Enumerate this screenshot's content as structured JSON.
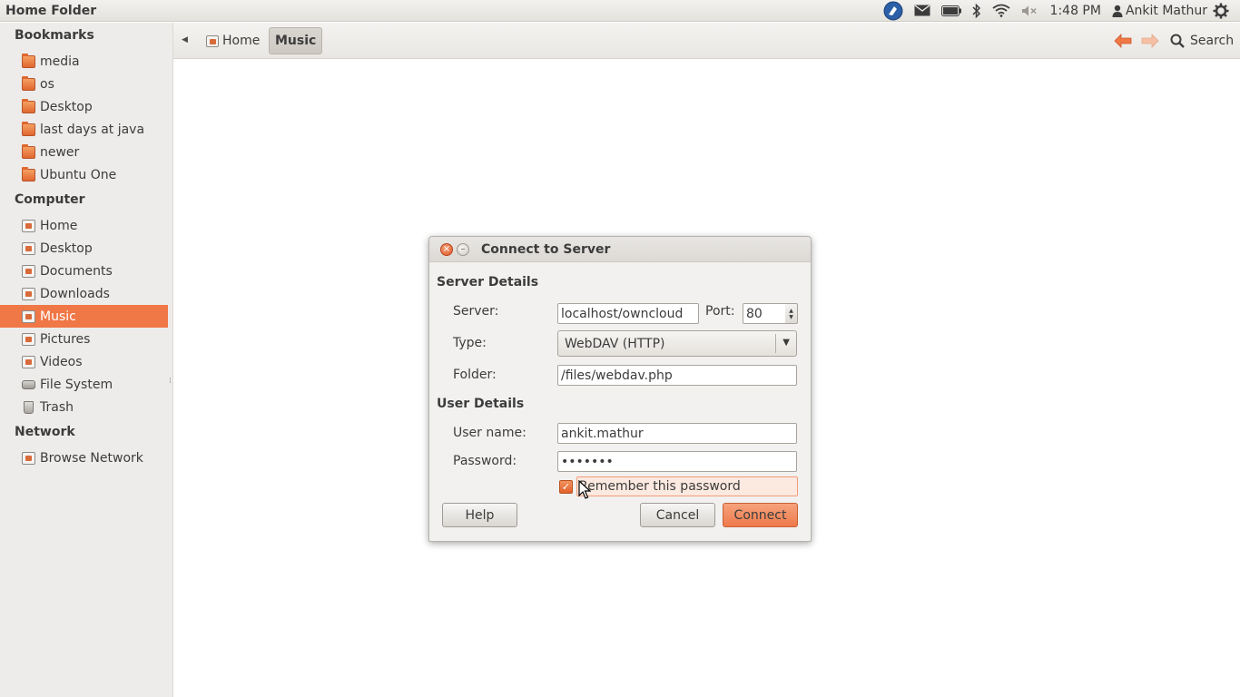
{
  "window_title": "Home Folder",
  "panel": {
    "clock": "1:48 PM",
    "user": "Ankit Mathur",
    "icons": [
      "app-indicator-icon",
      "mail-icon",
      "battery-icon",
      "bluetooth-icon",
      "wifi-icon",
      "volume-muted-icon",
      "user-icon",
      "session-gear-icon"
    ]
  },
  "sidebar": {
    "bookmarks_header": "Bookmarks",
    "bookmarks": [
      {
        "label": "media"
      },
      {
        "label": "os"
      },
      {
        "label": "Desktop"
      },
      {
        "label": "last days at java"
      },
      {
        "label": "newer"
      },
      {
        "label": "Ubuntu One"
      }
    ],
    "computer_header": "Computer",
    "computer": [
      {
        "label": "Home"
      },
      {
        "label": "Desktop"
      },
      {
        "label": "Documents"
      },
      {
        "label": "Downloads"
      },
      {
        "label": "Music",
        "selected": true
      },
      {
        "label": "Pictures"
      },
      {
        "label": "Videos"
      },
      {
        "label": "File System"
      },
      {
        "label": "Trash"
      }
    ],
    "network_header": "Network",
    "network": [
      {
        "label": "Browse Network"
      }
    ]
  },
  "toolbar": {
    "breadcrumbs": [
      {
        "label": "Home"
      },
      {
        "label": "Music",
        "active": true
      }
    ],
    "search_label": "Search"
  },
  "dialog": {
    "title": "Connect to Server",
    "server_details_header": "Server Details",
    "server_label": "Server:",
    "server_value": "localhost/owncloud",
    "port_label": "Port:",
    "port_value": "80",
    "type_label": "Type:",
    "type_value": "WebDAV (HTTP)",
    "folder_label": "Folder:",
    "folder_value": "/files/webdav.php",
    "user_details_header": "User Details",
    "username_label": "User name:",
    "username_value": "ankit.mathur",
    "password_label": "Password:",
    "password_value": "•••••••",
    "remember_label": "Remember this password",
    "remember_checked": true,
    "help_label": "Help",
    "cancel_label": "Cancel",
    "connect_label": "Connect"
  },
  "colors": {
    "accent": "#f07746",
    "sidebar_bg": "#edecea",
    "panel_bg": "#e9e7e3"
  }
}
